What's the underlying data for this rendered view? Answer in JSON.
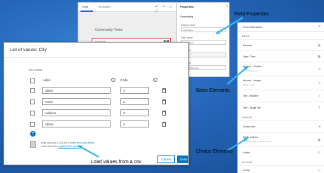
{
  "builder": {
    "tabs": [
      "Form",
      "Templates"
    ],
    "form_title": "Community Trees",
    "field_label": "Full Name",
    "toolbar_glyphs": "↶ ↷ ▭ ⤢"
  },
  "properties": {
    "title": "Properties",
    "section": "Formatting",
    "display_name_label": "Display name*",
    "display_name_value": "Full Name",
    "field_name_label": "Field name*",
    "field_name_value": "Full_Name",
    "field_type_label": "Field type",
    "field_type_value": "String",
    "input_type_label": "Input type",
    "input_type_value": "Text - Single line"
  },
  "elements_panel": {
    "title": "Form Elements",
    "groups": {
      "basic": "BASIC",
      "choice": "CHOICE",
      "layout": "LAYOUT"
    },
    "items": [
      {
        "name": "Barcode",
        "sub": ""
      },
      {
        "name": "Date / Time",
        "sub": ""
      },
      {
        "name": "Number - Double",
        "sub": "Decimal, e.g. 1.2"
      },
      {
        "name": "Number - Integer",
        "sub": "Whole, e.g. 1"
      },
      {
        "name": "Text - Multiline",
        "sub": ""
      },
      {
        "name": "Text - Single line",
        "sub": ""
      },
      {
        "name": "Combo box",
        "sub": ""
      },
      {
        "name": "Radio buttons",
        "sub": "Recommended for up to 5 values"
      },
      {
        "name": "Switch",
        "sub": ""
      },
      {
        "name": "Group",
        "sub": ""
      }
    ]
  },
  "dialog": {
    "title": "List of values: City",
    "count": "450 values",
    "col_label": "Label",
    "col_code": "Code",
    "rows": [
      {
        "label": "Abbot",
        "code": "1"
      },
      {
        "label": "Acton",
        "code": "2"
      },
      {
        "label": "Addison",
        "code": "3"
      },
      {
        "label": "Albion",
        "code": "4"
      }
    ],
    "drop_text": "Drag and drop a CSV file or ",
    "drop_link": "select from your device.",
    "learn_text": "Learn about the ",
    "learn_link": "required CSV format",
    "cancel": "Cancel",
    "done": "Done"
  },
  "annotations": {
    "field_properties": "Field Properties",
    "basic_elements": "Basic Elements",
    "choice_elements": "Choice Elements",
    "load_values": "Load values from a csv"
  }
}
